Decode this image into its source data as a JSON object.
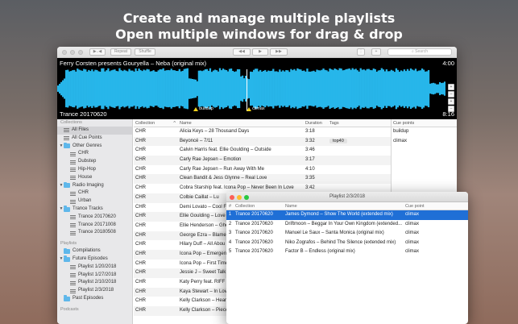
{
  "promo": {
    "line1": "Create and manage multiple playlists",
    "line2": "Open multiple windows for drag & drop"
  },
  "toolbar": {
    "nav_label": "▶..◀",
    "repeat_label": "Repeat",
    "shuffle_label": "Shuffle",
    "prev_label": "◀◀",
    "play_label": "▶",
    "next_label": "▶▶",
    "menu_label": "⋮",
    "add_label": "+",
    "search_placeholder": "Search",
    "search_icon": "magnifier-icon"
  },
  "player": {
    "track_title": "Ferry Corsten presents Gouryella – Neba (original mix)",
    "current_time": "4:00",
    "playlist": "Trance 20170620",
    "duration": "8:16",
    "progress_fraction": 0.487,
    "wave_color": "#27b6ea",
    "cue_points": [
      {
        "label": "buildup",
        "position_fraction": 0.357
      },
      {
        "label": "climax",
        "position_fraction": 0.494
      }
    ],
    "zoom_buttons": [
      "+",
      "–",
      "+",
      "–"
    ]
  },
  "sidebar": {
    "sections": [
      {
        "heading": "Collections",
        "items": [
          {
            "label": "All Files",
            "indent": 1,
            "icon": "list-icon",
            "selected": true
          },
          {
            "label": "All Cue Points",
            "indent": 1,
            "icon": "list-icon"
          },
          {
            "label": "Other Genres",
            "indent": 0,
            "icon": "folder-icon",
            "arrow": "▼"
          },
          {
            "label": "CHR",
            "indent": 2,
            "icon": "list-icon"
          },
          {
            "label": "Dubstep",
            "indent": 2,
            "icon": "list-icon"
          },
          {
            "label": "Hip-Hop",
            "indent": 2,
            "icon": "list-icon"
          },
          {
            "label": "House",
            "indent": 2,
            "icon": "list-icon"
          },
          {
            "label": "Radio Imaging",
            "indent": 0,
            "icon": "folder-icon",
            "arrow": "▼"
          },
          {
            "label": "CHR",
            "indent": 2,
            "icon": "list-icon"
          },
          {
            "label": "Urban",
            "indent": 2,
            "icon": "list-icon"
          },
          {
            "label": "Trance Tracks",
            "indent": 0,
            "icon": "folder-icon",
            "arrow": "▼"
          },
          {
            "label": "Trance 20170620",
            "indent": 2,
            "icon": "list-icon"
          },
          {
            "label": "Trance 20171008",
            "indent": 2,
            "icon": "list-icon"
          },
          {
            "label": "Trance 20180508",
            "indent": 2,
            "icon": "list-icon"
          }
        ]
      },
      {
        "heading": "Playlists",
        "items": [
          {
            "label": "Compilations",
            "indent": 1,
            "icon": "folder-icon"
          },
          {
            "label": "Future Episodes",
            "indent": 0,
            "icon": "folder-icon",
            "arrow": "▼"
          },
          {
            "label": "Playlist 1/20/2018",
            "indent": 2,
            "icon": "list-icon"
          },
          {
            "label": "Playlist 1/27/2018",
            "indent": 2,
            "icon": "list-icon"
          },
          {
            "label": "Playlist 2/10/2018",
            "indent": 2,
            "icon": "list-icon"
          },
          {
            "label": "Playlist 2/3/2018",
            "indent": 2,
            "icon": "list-icon"
          },
          {
            "label": "Past Episodes",
            "indent": 1,
            "icon": "folder-icon"
          }
        ]
      },
      {
        "heading": "Podcasts",
        "items": []
      }
    ]
  },
  "table": {
    "headers": [
      "Collection",
      "Name",
      "Duration",
      "Tags"
    ],
    "sort_indicator": "^",
    "rows": [
      {
        "collection": "CHR",
        "name": "Alicia Keys – 28 Thousand Days",
        "duration": "3:18",
        "tags": ""
      },
      {
        "collection": "CHR",
        "name": "Beyoncé – 7/11",
        "duration": "3:32",
        "tags": "top40"
      },
      {
        "collection": "CHR",
        "name": "Calvin Harris feat. Ellie Goulding – Outside",
        "duration": "3:46",
        "tags": ""
      },
      {
        "collection": "CHR",
        "name": "Carly Rae Jepsen – Emotion",
        "duration": "3:17",
        "tags": ""
      },
      {
        "collection": "CHR",
        "name": "Carly Rae Jepsen – Run Away With Me",
        "duration": "4:10",
        "tags": ""
      },
      {
        "collection": "CHR",
        "name": "Clean Bandit & Jess Glynne – Real Love",
        "duration": "3:35",
        "tags": ""
      },
      {
        "collection": "CHR",
        "name": "Cobra Starship feat. Icona Pop – Never Been In Love",
        "duration": "3:42",
        "tags": ""
      },
      {
        "collection": "CHR",
        "name": "Colbie Caillat – Lu",
        "duration": "",
        "tags": ""
      },
      {
        "collection": "CHR",
        "name": "Demi Lovato – Cool Fo",
        "duration": "",
        "tags": ""
      },
      {
        "collection": "CHR",
        "name": "Ellie Goulding – Love",
        "duration": "",
        "tags": ""
      },
      {
        "collection": "CHR",
        "name": "Ellie Henderson – Ghe",
        "duration": "",
        "tags": ""
      },
      {
        "collection": "CHR",
        "name": "George Ezra – Blame",
        "duration": "",
        "tags": ""
      },
      {
        "collection": "CHR",
        "name": "Hilary Duff – All Abou",
        "duration": "",
        "tags": ""
      },
      {
        "collection": "CHR",
        "name": "Icona Pop – Emergen",
        "duration": "",
        "tags": ""
      },
      {
        "collection": "CHR",
        "name": "Icona Pop – First Time",
        "duration": "",
        "tags": ""
      },
      {
        "collection": "CHR",
        "name": "Jessie J – Sweet Talk",
        "duration": "",
        "tags": ""
      },
      {
        "collection": "CHR",
        "name": "Katy Perry feat. RIFF R",
        "duration": "",
        "tags": ""
      },
      {
        "collection": "CHR",
        "name": "Kaya Stewart – In Love",
        "duration": "",
        "tags": ""
      },
      {
        "collection": "CHR",
        "name": "Kelly Clarkson – Heart",
        "duration": "",
        "tags": ""
      },
      {
        "collection": "CHR",
        "name": "Kelly Clarkson – Piece",
        "duration": "",
        "tags": ""
      }
    ]
  },
  "cue_panel": {
    "header": "Cue points",
    "rows": [
      "buildup",
      "climax"
    ]
  },
  "playlist_window": {
    "title": "Playlist 2/3/2018",
    "headers": [
      "#",
      "Collection",
      "Name",
      "Cue point"
    ],
    "rows": [
      {
        "num": "1",
        "collection": "Trance 20170620",
        "name": "James Dymond – Show The World (extended mix)",
        "cue": "climax",
        "selected": true
      },
      {
        "num": "2",
        "collection": "Trance 20170620",
        "name": "Driftmoon – Beggar In Your Own Kingdom (extended...",
        "cue": "climax"
      },
      {
        "num": "3",
        "collection": "Trance 20170620",
        "name": "Manuel Le Saux – Santa Monica (original mix)",
        "cue": "climax"
      },
      {
        "num": "4",
        "collection": "Trance 20170620",
        "name": "Niko Zografos – Behind The Silence (extended mix)",
        "cue": "climax"
      },
      {
        "num": "5",
        "collection": "Trance 20170620",
        "name": "Factor B – Endless (original mix)",
        "cue": "climax"
      }
    ],
    "traffic_colors": [
      "#fc5f57",
      "#fdbc2e",
      "#28c840"
    ]
  }
}
